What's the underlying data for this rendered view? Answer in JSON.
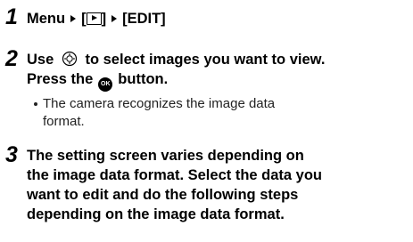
{
  "steps": [
    {
      "number": "1",
      "menu_label": "Menu",
      "playback_bracket_open": "[",
      "playback_bracket_close": "]",
      "edit_label": "[EDIT]"
    },
    {
      "number": "2",
      "line1_prefix": "Use",
      "line1_suffix": "to select images you want to view.",
      "line2_prefix": "Press the",
      "line2_suffix": "button.",
      "ok_text": "OK",
      "bullet_line1": "The camera recognizes the image data",
      "bullet_line2": "format."
    },
    {
      "number": "3",
      "lines": [
        "The setting screen varies depending on",
        "the image data format. Select the data you",
        "want to edit and do the following steps",
        "depending on the image data format."
      ]
    }
  ],
  "icons": {
    "menu_arrow": "triangle-right-icon",
    "playback": "playback-icon",
    "dial": "control-dial-icon",
    "ok": "ok-button-icon"
  }
}
